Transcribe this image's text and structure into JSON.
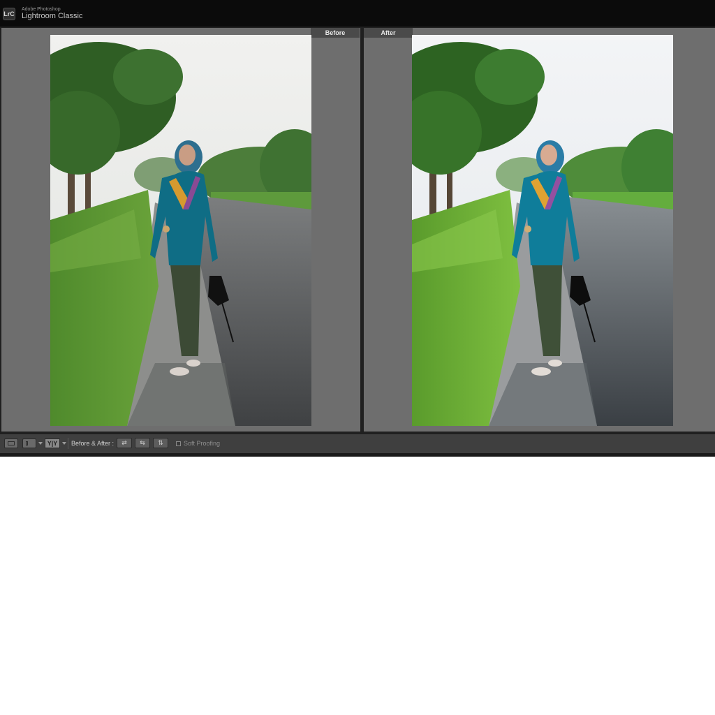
{
  "app": {
    "logo_text": "LrC",
    "vendor": "Adobe Photoshop",
    "name": "Lightroom Classic"
  },
  "viewer": {
    "before_label": "Before",
    "after_label": "After"
  },
  "toolbar": {
    "view_mode_label": "Y|Y",
    "before_after_label": "Before & After :",
    "swap_icons": [
      "copy-before-to-after-icon",
      "copy-after-to-before-icon",
      "swap-before-after-icon"
    ],
    "soft_proofing_label": "Soft Proofing",
    "soft_proofing_checked": false
  },
  "colors": {
    "titlebar": "#0b0b0b",
    "pane_background": "#6e6e6e",
    "toolbar": "#3f3f3f",
    "label_background": "#4a4a4a"
  }
}
